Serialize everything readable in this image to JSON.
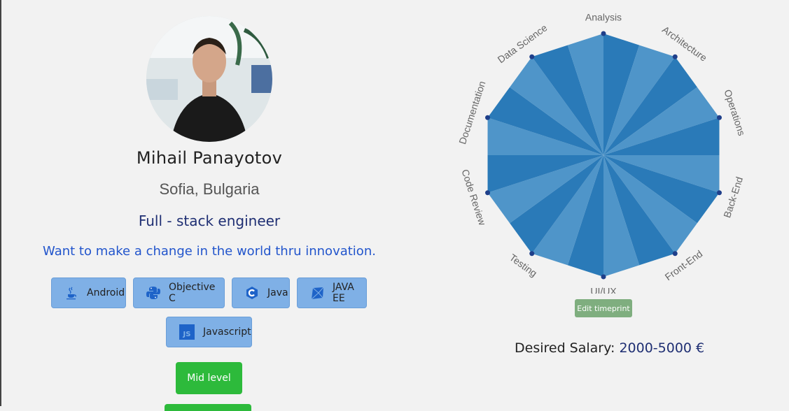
{
  "profile": {
    "name": "Mihail Panayotov",
    "location": "Sofia, Bulgaria",
    "role": "Full - stack engineer",
    "motto": "Want to make a change in the world thru innovation."
  },
  "skills": [
    {
      "label": "Android",
      "icon": "java-coffee-icon"
    },
    {
      "label": "Objective C",
      "icon": "python-icon"
    },
    {
      "label": "Java",
      "icon": "c-language-icon"
    },
    {
      "label": "JAVA EE",
      "icon": "ruby-gem-icon"
    },
    {
      "label": "Javascript",
      "icon": "js-icon"
    }
  ],
  "level": {
    "label": "Mid level"
  },
  "timeprint": {
    "axes": [
      "Analysis",
      "Architecture",
      "Operations",
      "Back-End",
      "Front-End",
      "UI/UX",
      "Testing",
      "Code Review",
      "Documentation",
      "Data Science"
    ],
    "edit_label": "Edit timeprint",
    "colors": {
      "dark": "#2a7ab8",
      "light": "#4f95c9",
      "point": "#1f3f8a"
    }
  },
  "salary": {
    "label": "Desired Salary:",
    "value": "2000-5000 €"
  }
}
